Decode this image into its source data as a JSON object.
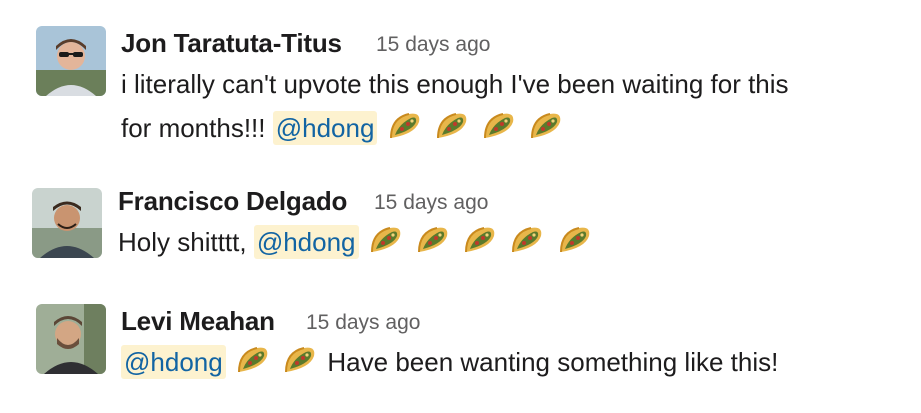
{
  "messages": [
    {
      "author": "Jon Taratuta-Titus",
      "time": "15 days ago",
      "line1": "i literally can't upvote this enough I've been waiting for this",
      "line2": "for months!!!",
      "mention": "@hdong",
      "reactions_icon": "taco-icon",
      "taco_count": 4
    },
    {
      "author": "Francisco Delgado",
      "time": "15 days ago",
      "text": "Holy shitttt,",
      "mention": "@hdong",
      "reactions_icon": "taco-icon",
      "taco_count": 5
    },
    {
      "author": "Levi Meahan",
      "time": "15 days ago",
      "mention": "@hdong",
      "text_after": "Have been wanting something like this!",
      "reactions_icon": "taco-icon",
      "taco_count": 2
    }
  ],
  "colors": {
    "mention_bg": "#fdf2cf",
    "mention_text": "#1264a3",
    "timestamp": "#616061",
    "text": "#1d1c1d"
  }
}
